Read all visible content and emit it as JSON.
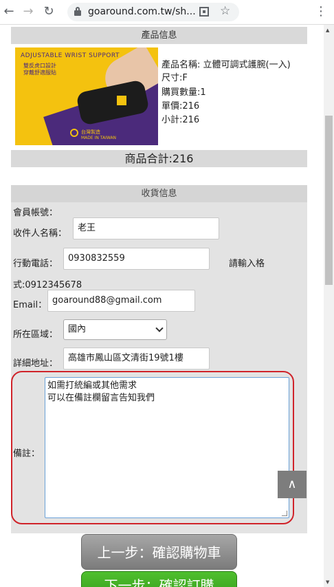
{
  "browser": {
    "back_icon": "arrow-left-icon",
    "forward_icon": "arrow-right-icon",
    "reload_icon": "reload-icon",
    "url": "goaround.com.tw/sh...",
    "menu_icon": "kebab-menu-icon"
  },
  "product_section": {
    "header": "產品信息",
    "image": {
      "line1": "ADJUSTABLE WRIST SUPPORT",
      "line2": "雙反虎口設計",
      "line3": "穿戴舒適服貼",
      "caption1": "台灣製造",
      "caption2": "MADE IN TAIWAN"
    },
    "name": "產品名稱: 立體可調式護腕(一入)",
    "size": "尺寸:F",
    "quantity": "購買數量:1",
    "unit_price": "單價:216",
    "subtotal": "小計:216",
    "total": "商品合計:216"
  },
  "shipping": {
    "header": "收貨信息",
    "member_label": "會員帳號：",
    "recipient_label": "收件人名稱：",
    "recipient_value": "老王",
    "phone_label": "行動電話：",
    "phone_value": "0930832559",
    "phone_hint_1": "請輸入格",
    "phone_hint_2": "式:0912345678",
    "email_label": "Email：",
    "email_value": "goaround88@gmail.com",
    "region_label": "所在區域：",
    "region_value": "國內",
    "address_label": "詳細地址：",
    "address_value": "高雄市鳳山區文清街19號1樓",
    "notes_label": "備註：",
    "notes_value": "如需打統編或其他需求\n可以在備註欄留言告知我們"
  },
  "back_to_top": "∧",
  "buttons": {
    "prev": "上一步：確認購物車",
    "next": "下一步：確認訂購"
  },
  "colors": {
    "highlight": "#d0232a",
    "next_button": "#3aa51f",
    "prev_button": "#8f8f8f"
  }
}
